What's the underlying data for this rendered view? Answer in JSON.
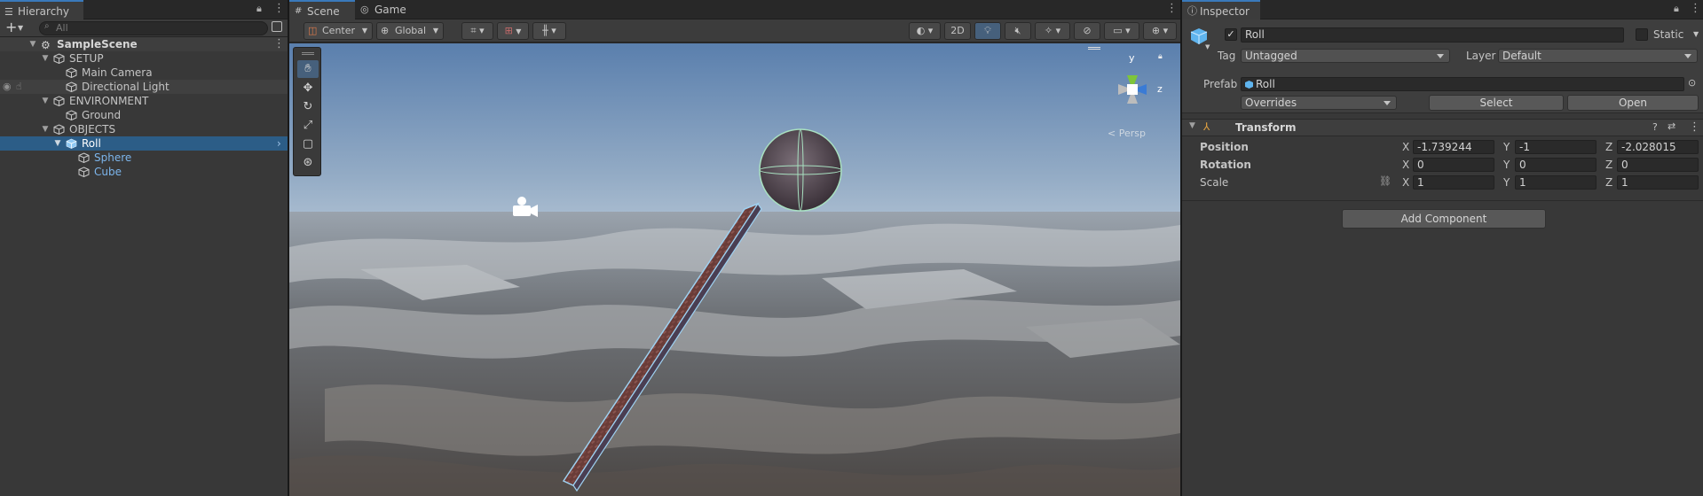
{
  "hierarchy": {
    "tab_label": "Hierarchy",
    "search_placeholder": "All",
    "add_label": "+",
    "scene_name": "SampleScene",
    "items": [
      {
        "label": "SETUP"
      },
      {
        "label": "Main Camera"
      },
      {
        "label": "Directional Light"
      },
      {
        "label": "ENVIRONMENT"
      },
      {
        "label": "Ground"
      },
      {
        "label": "OBJECTS"
      },
      {
        "label": "Roll"
      },
      {
        "label": "Sphere"
      },
      {
        "label": "Cube"
      }
    ]
  },
  "scene_view": {
    "tabs": [
      {
        "label": "Scene"
      },
      {
        "label": "Game"
      }
    ],
    "pivot_mode": "Center",
    "pivot_rotation": "Global",
    "mode_2d": "2D",
    "gizmo": {
      "y_label": "y",
      "z_label": "z",
      "projection": "< Persp"
    }
  },
  "inspector": {
    "tab_label": "Inspector",
    "object_name": "Roll",
    "static_label": "Static",
    "tag_label": "Tag",
    "tag_value": "Untagged",
    "layer_label": "Layer",
    "layer_value": "Default",
    "prefab_label": "Prefab",
    "prefab_value": "Roll",
    "overrides_label": "Overrides",
    "select_label": "Select",
    "open_label": "Open",
    "transform": {
      "title": "Transform",
      "position": {
        "label": "Position",
        "x": "-1.739244",
        "y": "-1",
        "z": "-2.028015"
      },
      "rotation": {
        "label": "Rotation",
        "x": "0",
        "y": "0",
        "z": "0"
      },
      "scale": {
        "label": "Scale",
        "x": "1",
        "y": "1",
        "z": "1"
      },
      "axis_x": "X",
      "axis_y": "Y",
      "axis_z": "Z"
    },
    "add_component_label": "Add Component"
  },
  "colors": {
    "selection": "#2c5d87",
    "prefab_text": "#7cb5ec",
    "accent": "#3a79bb"
  }
}
